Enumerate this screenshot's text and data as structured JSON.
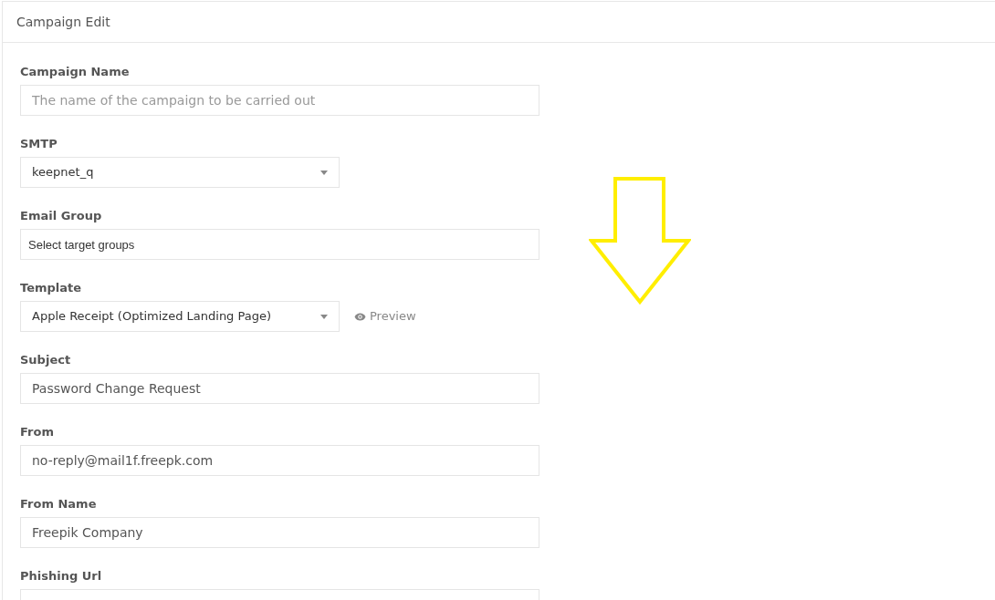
{
  "panel": {
    "title": "Campaign Edit"
  },
  "fields": [
    {
      "kind": "text",
      "label": "Campaign Name",
      "placeholder": "The name of the campaign to be carried out"
    },
    {
      "kind": "select",
      "label": "SMTP",
      "value": "keepnet_q"
    },
    {
      "kind": "tags",
      "label": "Email Group",
      "placeholder": "Select target groups"
    },
    {
      "kind": "select",
      "label": "Template",
      "value": "Apple Receipt (Optimized Landing Page)",
      "link": "Preview"
    },
    {
      "kind": "text",
      "label": "Subject",
      "value": "Password Change Request"
    },
    {
      "kind": "text",
      "label": "From",
      "value": "no-reply@mail1f.freepk.com"
    },
    {
      "kind": "text",
      "label": "From Name",
      "value": "Freepik Company"
    },
    {
      "kind": "text",
      "label": "Phishing Url"
    }
  ]
}
